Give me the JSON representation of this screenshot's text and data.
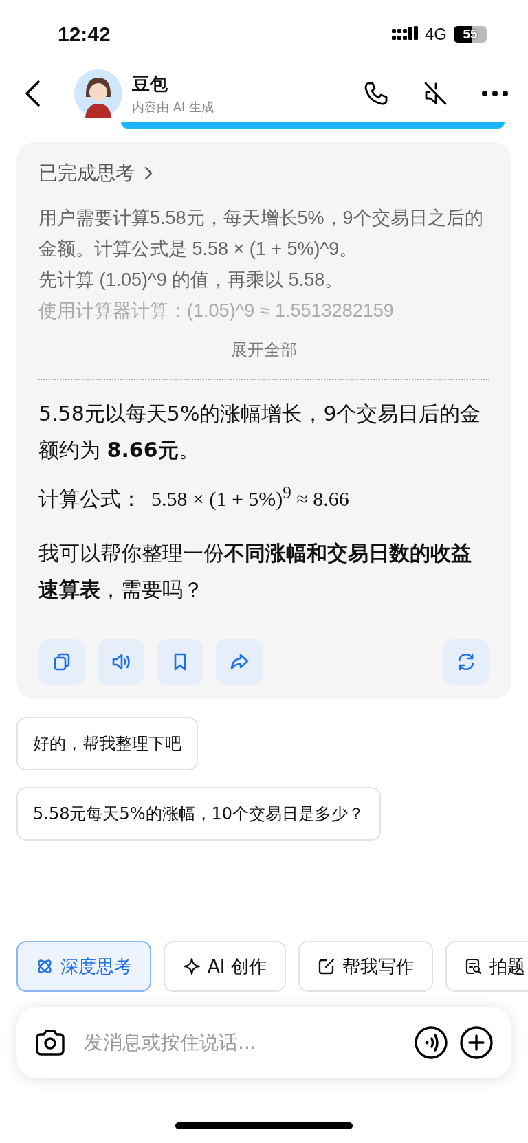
{
  "status_bar": {
    "time": "12:42",
    "network": "4G",
    "battery": "55"
  },
  "header": {
    "title": "豆包",
    "subtitle": "内容由 AI 生成"
  },
  "thinking": {
    "title": "已完成思考",
    "lines": [
      "用户需要计算5.58元，每天增长5%，9个交易日之后的金额。计算公式是 5.58 × (1 + 5%)^9。",
      "先计算 (1.05)^9 的值，再乘以 5.58。",
      "使用计算器计算：(1.05)^9 ≈ 1.5513282159"
    ],
    "expand": "展开全部"
  },
  "answer": {
    "summary": "5.58元以每天5%的涨幅增长，9个交易日后的金额约为 **8.66元**。",
    "formula_label": "计算公式：",
    "formula": "5.58 × (1 + 5%)$^{9}$ ≈ 8.66",
    "offer": "我可以帮你整理一份**不同涨幅和交易日数的收益速算表**，需要吗？"
  },
  "suggestions": [
    "好的，帮我整理下吧",
    "5.58元每天5%的涨幅，10个交易日是多少？"
  ],
  "chips": [
    {
      "label": "深度思考",
      "selected": true
    },
    {
      "label": "AI 创作",
      "selected": false
    },
    {
      "label": "帮我写作",
      "selected": false
    },
    {
      "label": "拍题",
      "selected": false
    }
  ],
  "input": {
    "placeholder": "发消息或按住说话..."
  }
}
